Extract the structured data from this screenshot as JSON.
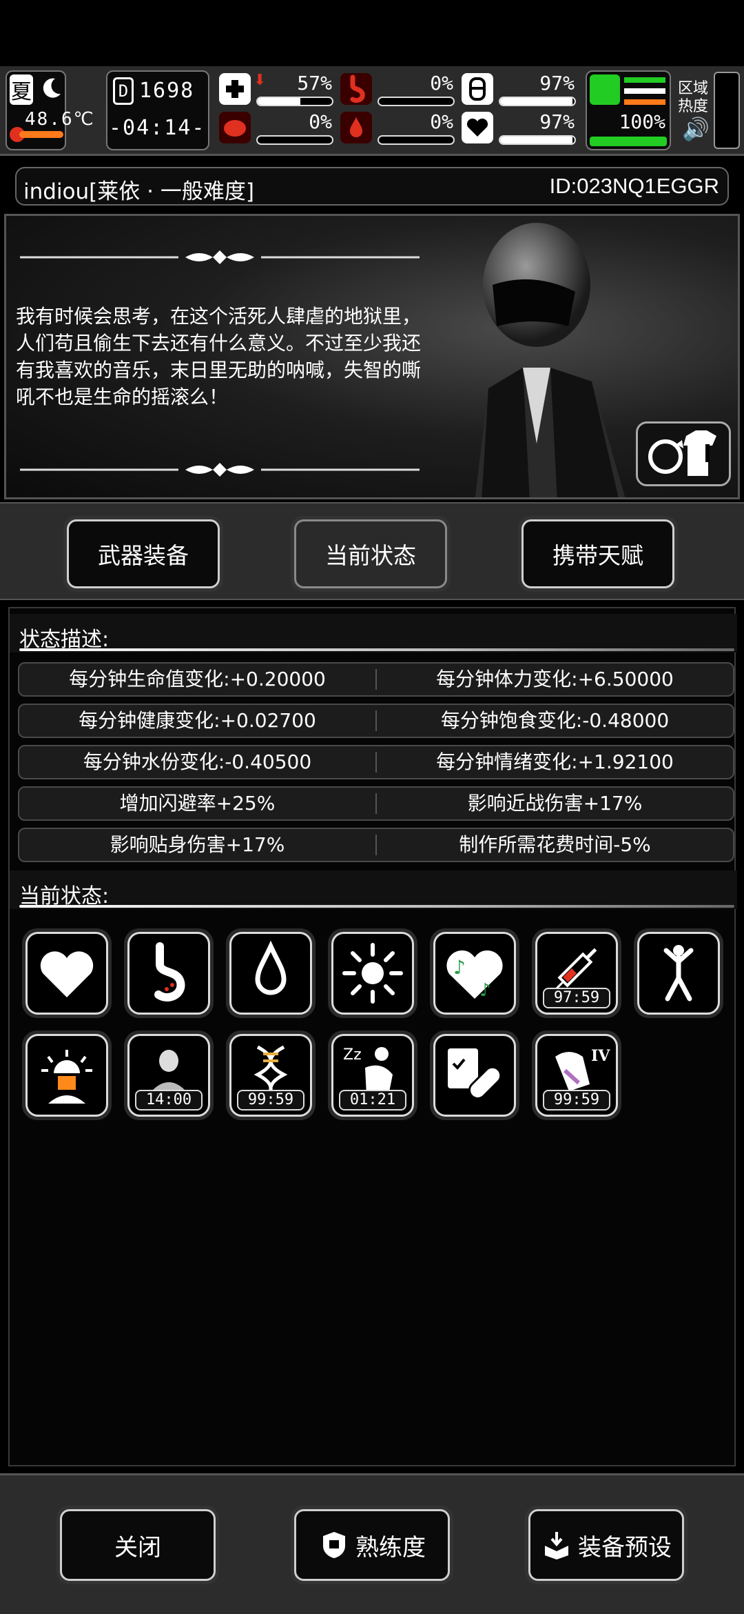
{
  "hud": {
    "season": "夏",
    "temperature": "48.6℃",
    "day": "1698",
    "clock": "-04:14-",
    "region_label": "区域热度",
    "stats": [
      {
        "name": "health",
        "percent": "57%",
        "value": 0.57,
        "color": "#ffffff"
      },
      {
        "name": "stomach",
        "percent": "0%",
        "value": 0.0,
        "color": "#ffffff"
      },
      {
        "name": "stamina",
        "percent": "97%",
        "value": 0.97,
        "color": "#ffffff"
      },
      {
        "name": "brain",
        "percent": "0%",
        "value": 0.0,
        "color": "#ffffff"
      },
      {
        "name": "water",
        "percent": "0%",
        "value": 0.0,
        "color": "#ffffff"
      },
      {
        "name": "mood",
        "percent": "97%",
        "value": 0.97,
        "color": "#ffffff"
      }
    ],
    "energy_percent": "100%",
    "energy_value": 1.0,
    "accent_red": "#e03020",
    "accent_green": "#22cc22",
    "accent_orange": "#ff7a1a"
  },
  "player": {
    "name": "indiou[莱依 · 一般难度]",
    "id": "ID:023NQ1EGGR"
  },
  "portrait": {
    "quote": "我有时候会思考，在这个活死人肆虐的地狱里，人们苟且偷生下去还有什么意义。不过至少我还有我喜欢的音乐，末日里无助的呐喊，失智的嘶吼不也是生命的摇滚么！"
  },
  "tabs": [
    {
      "label": "武器装备"
    },
    {
      "label": "当前状态"
    },
    {
      "label": "携带天赋"
    }
  ],
  "status": {
    "desc_title": "状态描述:",
    "rows": [
      [
        "每分钟生命值变化:+0.20000",
        "每分钟体力变化:+6.50000"
      ],
      [
        "每分钟健康变化:+0.02700",
        "每分钟饱食变化:-0.48000"
      ],
      [
        "每分钟水份变化:-0.40500",
        "每分钟情绪变化:+1.92100"
      ],
      [
        "增加闪避率+25%",
        "影响近战伤害+17%"
      ],
      [
        "影响贴身伤害+17%",
        "制作所需花费时间-5%"
      ]
    ],
    "current_title": "当前状态:",
    "icons": [
      {
        "name": "heart-icon",
        "timer": ""
      },
      {
        "name": "stomach-icon",
        "timer": ""
      },
      {
        "name": "water-drop-icon",
        "timer": ""
      },
      {
        "name": "sun-icon",
        "timer": ""
      },
      {
        "name": "music-heart-icon",
        "timer": ""
      },
      {
        "name": "syringe-icon",
        "timer": "97:59"
      },
      {
        "name": "stretch-figure-icon",
        "timer": ""
      },
      {
        "name": "alarm-person-icon",
        "timer": ""
      },
      {
        "name": "old-man-icon",
        "timer": "14:00"
      },
      {
        "name": "dna-icon",
        "timer": "99:59"
      },
      {
        "name": "sleeping-icon",
        "timer": "01:21"
      },
      {
        "name": "medical-pill-icon",
        "timer": ""
      },
      {
        "name": "wounded-arm-icon",
        "timer": "99:59",
        "badge": "IV"
      }
    ]
  },
  "bottom": {
    "close": "关闭",
    "proficiency": "熟练度",
    "preset": "装备预设"
  }
}
